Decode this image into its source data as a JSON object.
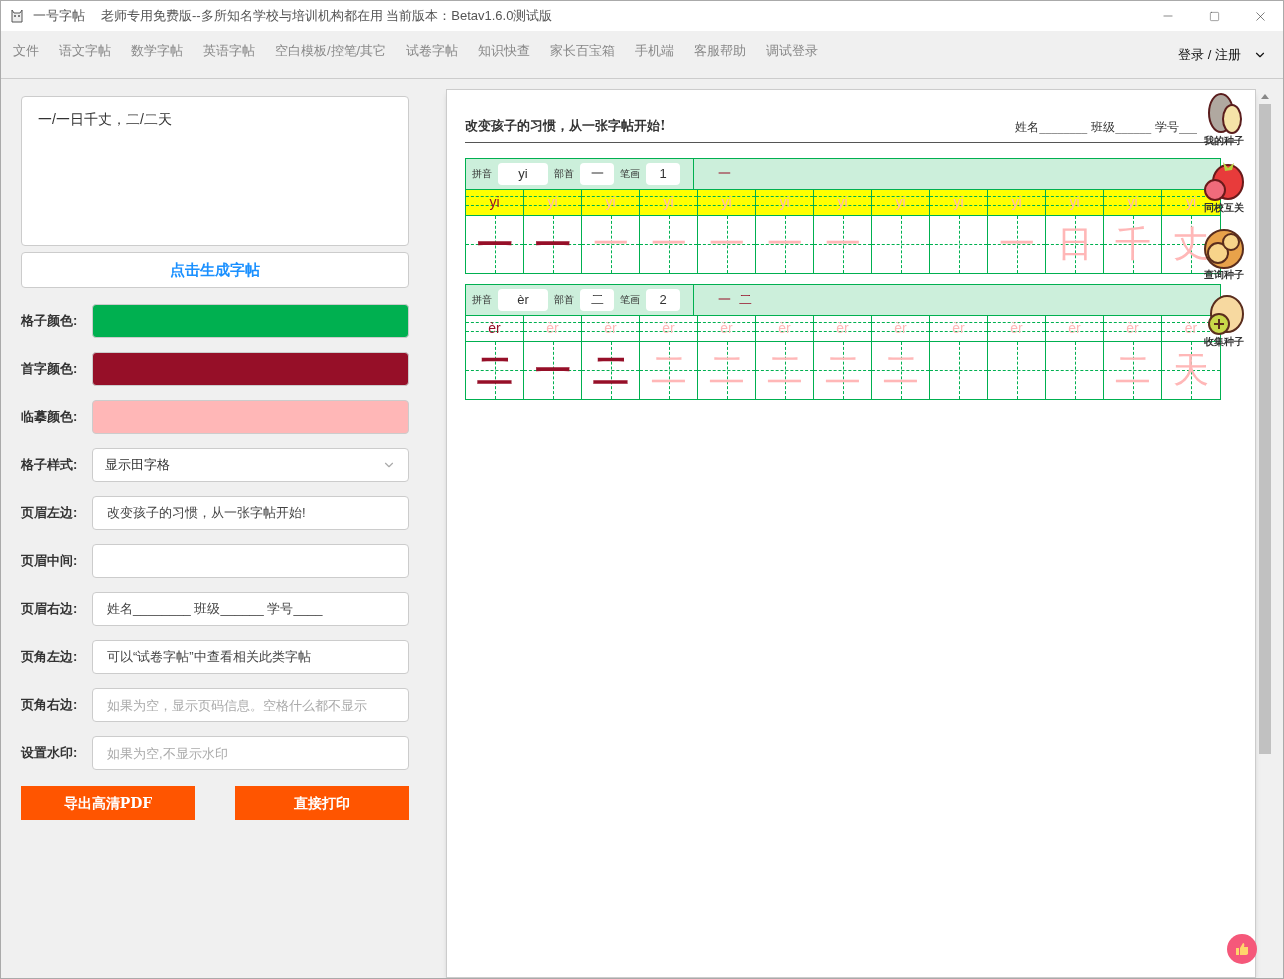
{
  "window": {
    "app_name": "一号字帖",
    "title": "老师专用免费版--多所知名学校与培训机构都在用 当前版本：Betav1.6.0测试版"
  },
  "menu": [
    "文件",
    "语文字帖",
    "数学字帖",
    "英语字帖",
    "空白模板/控笔/其它",
    "试卷字帖",
    "知识快查",
    "家长百宝箱",
    "手机端",
    "客服帮助",
    "调试登录"
  ],
  "account": "登录 / 注册",
  "input_text": "一/一日千丈，二/二天",
  "generate_button": "点击生成字帖",
  "fields": [
    {
      "kind": "color",
      "label": "格子颜色:",
      "color": "#00b050"
    },
    {
      "kind": "color",
      "label": "首字颜色:",
      "color": "#960f28"
    },
    {
      "kind": "color",
      "label": "临摹颜色:",
      "color": "#ffb7b7"
    },
    {
      "kind": "select",
      "label": "格子样式:",
      "value": "显示田字格"
    },
    {
      "kind": "text",
      "label": "页眉左边:",
      "value": "改变孩子的习惯，从一张字帖开始!"
    },
    {
      "kind": "text",
      "label": "页眉中间:"
    },
    {
      "kind": "text",
      "label": "页眉右边:",
      "value": "姓名________ 班级______ 学号____"
    },
    {
      "kind": "text",
      "label": "页角左边:",
      "value": "可以“试卷字帖”中查看相关此类字帖"
    },
    {
      "kind": "text",
      "label": "页角右边:",
      "placeholder": "如果为空，显示页码信息。空格什么都不显示"
    },
    {
      "kind": "text",
      "label": "设置水印:",
      "placeholder": "如果为空,不显示水印"
    }
  ],
  "actions": [
    "导出高清PDF",
    "直接打印"
  ],
  "sheet": {
    "header_left": "改变孩子的习惯，从一张字帖开始!",
    "header_right": "姓名________ 班级______ 学号___",
    "rows": [
      {
        "labels": [
          "拼音",
          "部首",
          "笔画"
        ],
        "pinyin": "yi",
        "radical": "一",
        "strokes": "1",
        "stroke_order": [
          "一"
        ],
        "pinyin_highlight": true,
        "pinyin_cells": [
          "yi",
          "yi",
          "yi",
          "yi",
          "yi",
          "yi",
          "yi",
          "yi",
          "yi",
          "yi",
          "yi",
          "yi",
          "yi"
        ],
        "cells": [
          {
            "kind": "char",
            "char": "一",
            "first": true
          },
          {
            "kind": "char",
            "char": "一",
            "first": true
          },
          {
            "kind": "char",
            "char": "一",
            "first": false
          },
          {
            "kind": "char",
            "char": "一",
            "first": false
          },
          {
            "kind": "char",
            "char": "一",
            "first": false
          },
          {
            "kind": "char",
            "char": "一",
            "first": false
          },
          {
            "kind": "char",
            "char": "一",
            "first": false
          },
          {
            "kind": "empty"
          },
          {
            "kind": "empty"
          },
          {
            "kind": "char",
            "char": "一",
            "first": false
          },
          {
            "kind": "char",
            "char": "日",
            "first": false
          },
          {
            "kind": "char",
            "char": "千",
            "first": false
          },
          {
            "kind": "char",
            "char": "丈",
            "first": false
          }
        ]
      },
      {
        "labels": [
          "拼音",
          "部首",
          "笔画"
        ],
        "pinyin": "èr",
        "radical": "二",
        "strokes": "2",
        "stroke_order": [
          "一",
          "二"
        ],
        "pinyin_highlight": false,
        "pinyin_cells": [
          "èr",
          "èr",
          "èr",
          "èr",
          "èr",
          "èr",
          "èr",
          "èr",
          "èr",
          "èr",
          "èr",
          "èr",
          "èr"
        ],
        "cells": [
          {
            "kind": "char",
            "char": "二",
            "first": true
          },
          {
            "kind": "char",
            "char": "一",
            "first": true
          },
          {
            "kind": "char",
            "char": "二",
            "first": true
          },
          {
            "kind": "char",
            "char": "二",
            "first": false
          },
          {
            "kind": "char",
            "char": "二",
            "first": false
          },
          {
            "kind": "char",
            "char": "二",
            "first": false
          },
          {
            "kind": "char",
            "char": "二",
            "first": false
          },
          {
            "kind": "char",
            "char": "二",
            "first": false
          },
          {
            "kind": "empty"
          },
          {
            "kind": "empty"
          },
          {
            "kind": "empty"
          },
          {
            "kind": "char",
            "char": "二",
            "first": false
          },
          {
            "kind": "char",
            "char": "天",
            "first": false
          }
        ]
      }
    ]
  },
  "side_tools": [
    "我的种子",
    "同校互关",
    "查询种子",
    "收集种子"
  ]
}
